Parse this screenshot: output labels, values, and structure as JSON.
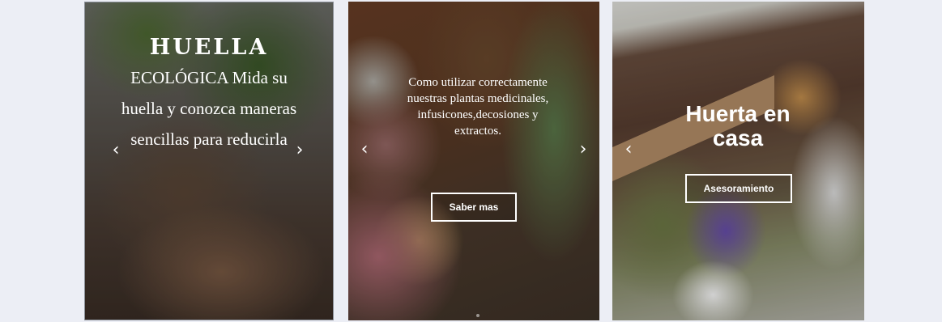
{
  "slides": [
    {
      "title": "HUELLA",
      "body": "ECOLÓGICA Mida su huella y conozca maneras sencillas para reducirla",
      "prev_icon": "chevron-left-icon",
      "next_icon": "chevron-right-icon"
    },
    {
      "body": "Como utilizar correctamente nuestras plantas medicinales, infusicones,decosiones y extractos.",
      "button_label": "Saber mas",
      "prev_icon": "chevron-left-icon",
      "next_icon": "chevron-right-icon"
    },
    {
      "title": "Huerta en casa",
      "button_label": "Asesoramiento",
      "prev_icon": "chevron-left-icon"
    }
  ],
  "arrows": {
    "prev": "‹",
    "next": "›"
  }
}
